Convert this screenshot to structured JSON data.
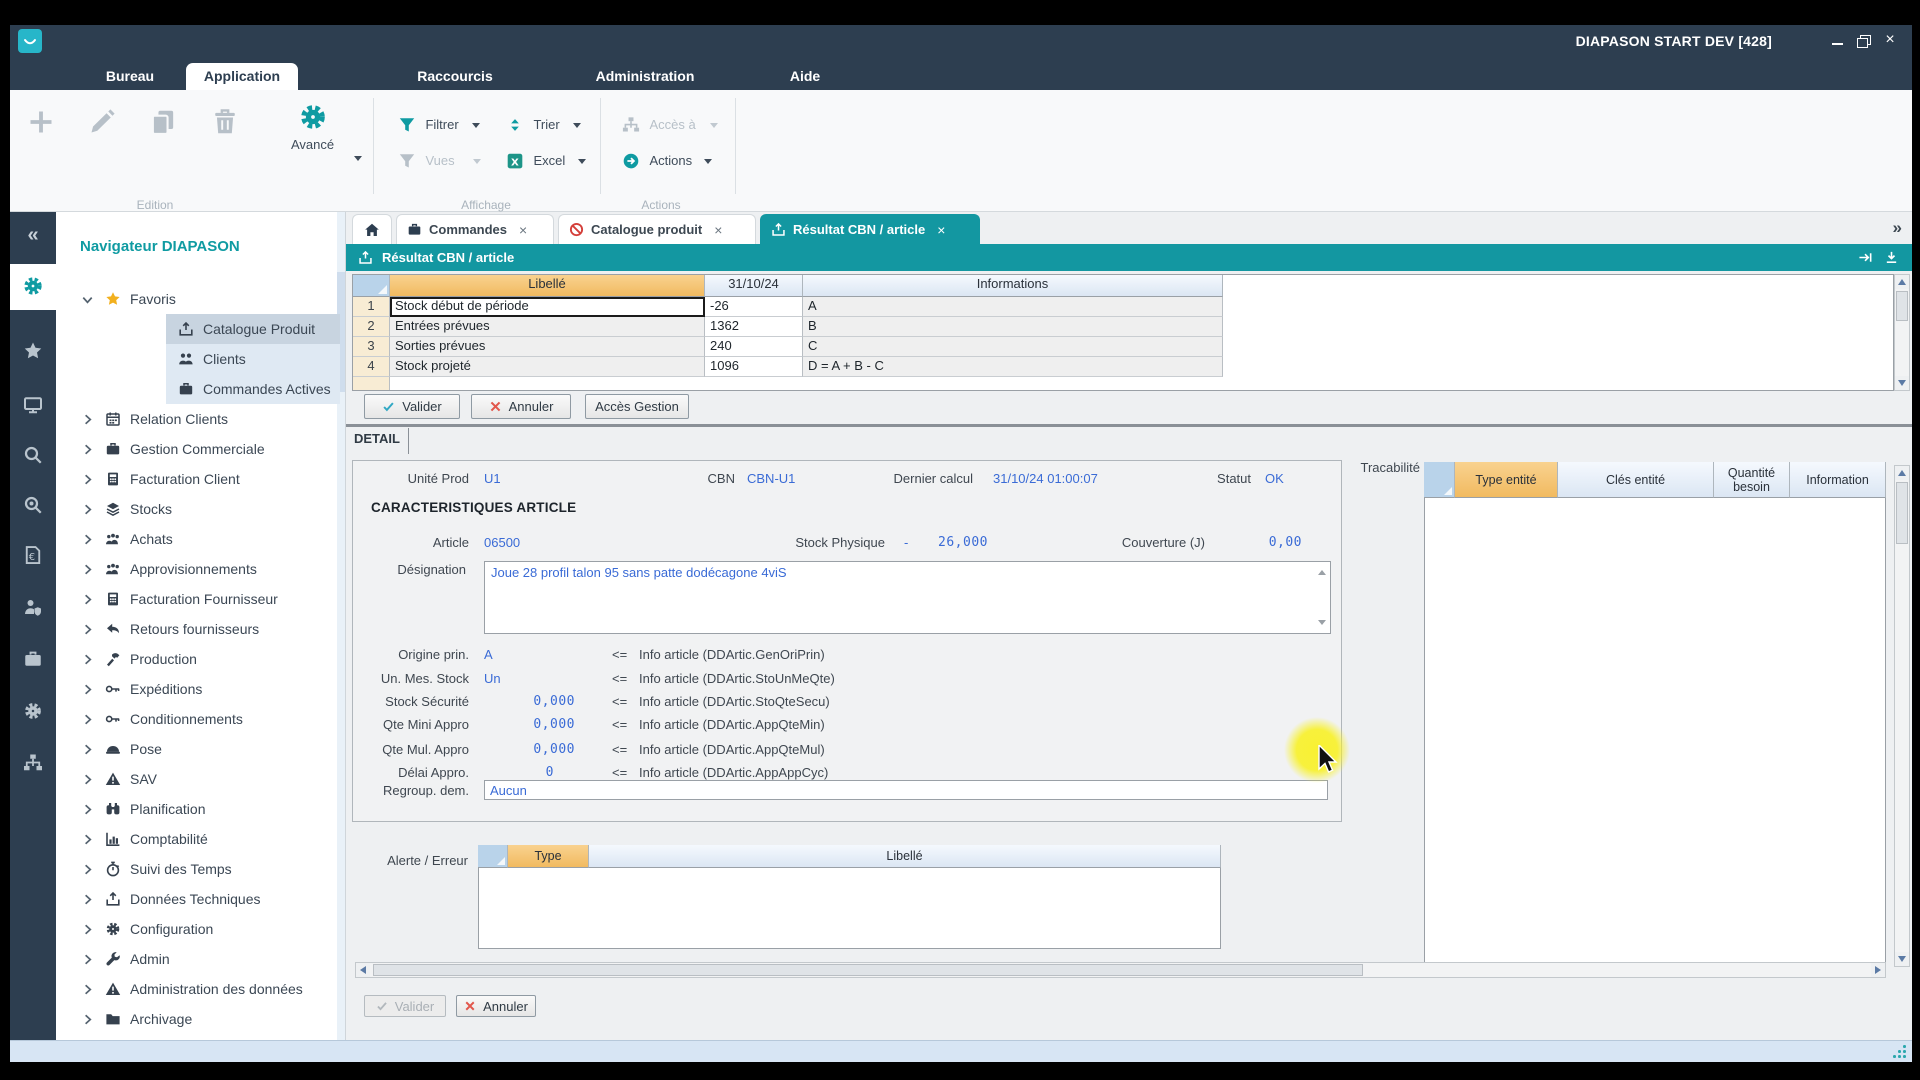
{
  "window": {
    "title": "DIAPASON START DEV [428]"
  },
  "glyphs": {
    "close": "×",
    "collapse": "«",
    "more_tabs": "»",
    "minimize": "–"
  },
  "colors": {
    "accent_teal": "#1397a1",
    "navy": "#2d3e50",
    "header_orange": "#f3c071",
    "value_blue": "#3a6bd6",
    "star_yellow": "#f2b01e",
    "annuler_red": "#e2574c",
    "highlight_yellow": "#f8f128"
  },
  "menu": {
    "tabs": [
      {
        "label": "Bureau"
      },
      {
        "label": "Application",
        "active": true
      },
      {
        "label": "Raccourcis"
      },
      {
        "label": "Administration"
      },
      {
        "label": "Aide"
      }
    ]
  },
  "ribbon": {
    "avance": "Avancé",
    "buttons": {
      "filtrer": "Filtrer",
      "trier": "Trier",
      "vues": "Vues",
      "excel": "Excel",
      "acces_a": "Accès à",
      "actions": "Actions"
    },
    "group_labels": {
      "edition": "Edition",
      "affichage": "Affichage",
      "actions": "Actions"
    }
  },
  "sidebar": {
    "title": "Navigateur DIAPASON",
    "items": [
      {
        "label": "Favoris",
        "level": 0,
        "expanded": true
      },
      {
        "label": "Catalogue Produit",
        "level": 1,
        "selected": true
      },
      {
        "label": "Clients",
        "level": 1
      },
      {
        "label": "Commandes Actives",
        "level": 1
      },
      {
        "label": "Relation Clients",
        "level": 0
      },
      {
        "label": "Gestion Commerciale",
        "level": 0
      },
      {
        "label": "Facturation Client",
        "level": 0
      },
      {
        "label": "Stocks",
        "level": 0
      },
      {
        "label": "Achats",
        "level": 0
      },
      {
        "label": "Approvisionnements",
        "level": 0
      },
      {
        "label": "Facturation Fournisseur",
        "level": 0
      },
      {
        "label": "Retours fournisseurs",
        "level": 0
      },
      {
        "label": "Production",
        "level": 0
      },
      {
        "label": "Expéditions",
        "level": 0
      },
      {
        "label": "Conditionnements",
        "level": 0
      },
      {
        "label": "Pose",
        "level": 0
      },
      {
        "label": "SAV",
        "level": 0
      },
      {
        "label": "Planification",
        "level": 0
      },
      {
        "label": "Comptabilité",
        "level": 0
      },
      {
        "label": "Suivi des Temps",
        "level": 0
      },
      {
        "label": "Données Techniques",
        "level": 0
      },
      {
        "label": "Configuration",
        "level": 0
      },
      {
        "label": "Admin",
        "level": 0
      },
      {
        "label": "Administration des données",
        "level": 0
      },
      {
        "label": "Archivage",
        "level": 0
      }
    ]
  },
  "doc_tabs": [
    {
      "label": "Commandes"
    },
    {
      "label": "Catalogue produit"
    },
    {
      "label": "Résultat CBN / article",
      "active": true
    }
  ],
  "panel": {
    "title": "Résultat CBN / article"
  },
  "grid": {
    "columns": {
      "libelle": "Libellé",
      "date": "31/10/24",
      "informations": "Informations"
    },
    "rows": [
      {
        "num": "1",
        "libelle": "Stock début de période",
        "value": "-26",
        "info": "A"
      },
      {
        "num": "2",
        "libelle": "Entrées prévues",
        "value": "1362",
        "info": "B"
      },
      {
        "num": "3",
        "libelle": "Sorties prévues",
        "value": "240",
        "info": "C"
      },
      {
        "num": "4",
        "libelle": "Stock projeté",
        "value": "1096",
        "info": "D = A + B - C"
      }
    ]
  },
  "toolbar": {
    "valider": "Valider",
    "annuler": "Annuler",
    "acces_gestion": "Accès Gestion"
  },
  "detail": {
    "tab": "DETAIL",
    "unite_prod": {
      "label": "Unité Prod",
      "value": "U1"
    },
    "cbn": {
      "label": "CBN",
      "value": "CBN-U1"
    },
    "dernier_calcul": {
      "label": "Dernier calcul",
      "value": "31/10/24 01:00:07"
    },
    "statut": {
      "label": "Statut",
      "value": "OK"
    },
    "section": "CARACTERISTIQUES ARTICLE",
    "article": {
      "label": "Article",
      "value": "06500"
    },
    "stock_physique": {
      "label": "Stock Physique",
      "sign": "-",
      "value": "26,000"
    },
    "couverture": {
      "label": "Couverture (J)",
      "value": "0,00"
    },
    "designation": {
      "label": "Désignation",
      "value": "Joue 28 profil talon 95 sans patte dodécagone 4viS"
    },
    "rows": [
      {
        "label": "Origine prin.",
        "value": "A",
        "arrow": "<=",
        "info": "Info article (DDArtic.GenOriPrin)"
      },
      {
        "label": "Un. Mes. Stock",
        "value": "Un",
        "arrow": "<=",
        "info": "Info article (DDArtic.StoUnMeQte)"
      },
      {
        "label": "Stock Sécurité",
        "value": "0,000",
        "arrow": "<=",
        "info": "Info article (DDArtic.StoQteSecu)"
      },
      {
        "label": "Qte Mini Appro",
        "value": "0,000",
        "arrow": "<=",
        "info": "Info article (DDArtic.AppQteMin)"
      },
      {
        "label": "Qte Mul. Appro",
        "value": "0,000",
        "arrow": "<=",
        "info": "Info article (DDArtic.AppQteMul)"
      },
      {
        "label": "Délai Appro.",
        "value": "0",
        "arrow": "<=",
        "info": "Info article (DDArtic.AppAppCyc)"
      }
    ],
    "regroup": {
      "label": "Regroup. dem.",
      "value": "Aucun"
    }
  },
  "alerte": {
    "label": "Alerte / Erreur",
    "columns": {
      "type": "Type",
      "libelle": "Libellé"
    }
  },
  "tracabilite": {
    "label": "Tracabilité",
    "columns": {
      "type_entite": "Type entité",
      "cles_entite": "Clés entité",
      "quantite_besoin": "Quantité besoin",
      "information": "Information"
    }
  },
  "footer": {
    "valider": "Valider",
    "annuler": "Annuler"
  }
}
